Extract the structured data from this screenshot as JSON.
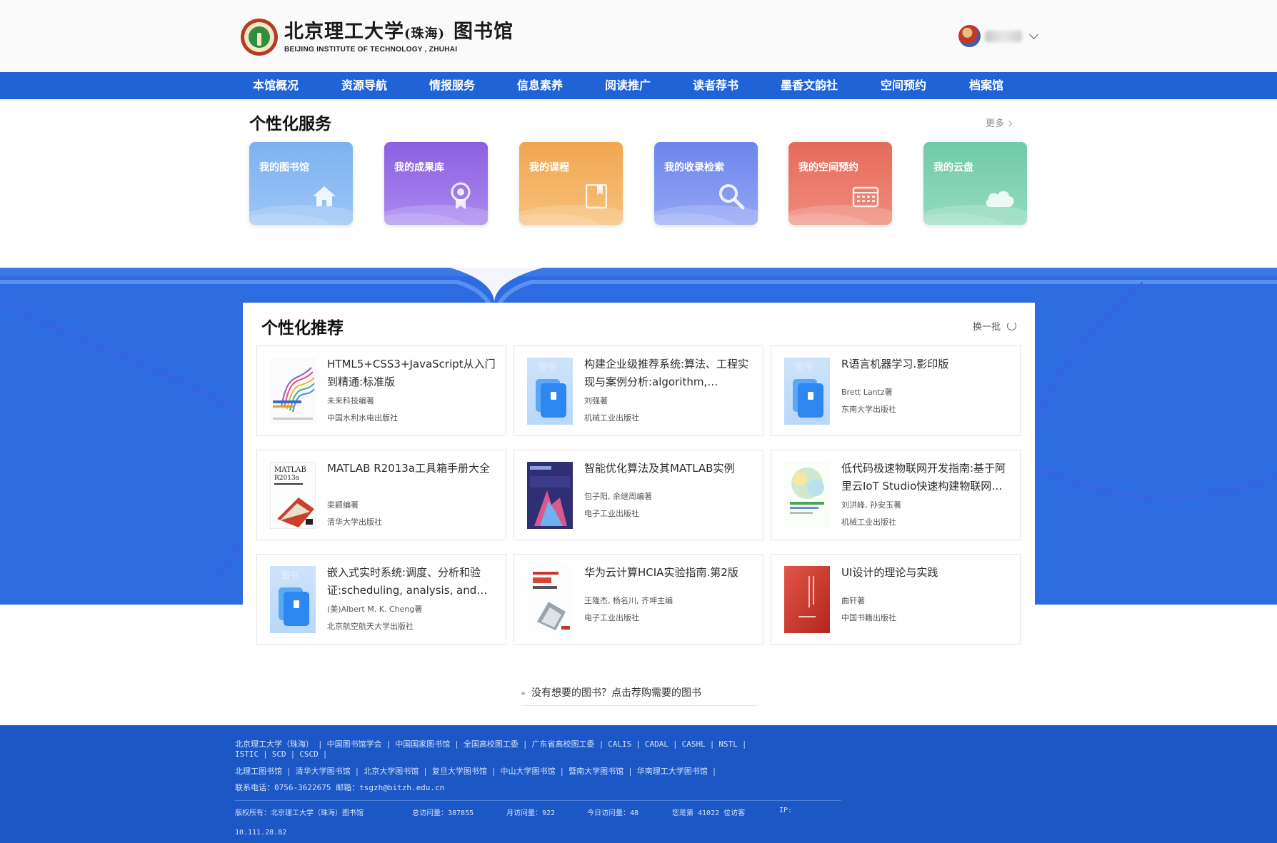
{
  "header": {
    "logo_cn": "北京理工大学",
    "logo_cn_small": "(珠海)",
    "logo_cn_lib": "图书馆",
    "logo_en": "BEIJING INSTITUTE OF TECHNOLOGY , ZHUHAI"
  },
  "nav": {
    "items": [
      "本馆概况",
      "资源导航",
      "情报服务",
      "信息素养",
      "阅读推广",
      "读者荐书",
      "墨香文韵社",
      "空间预约",
      "档案馆"
    ]
  },
  "services": {
    "title": "个性化服务",
    "more": "更多",
    "cards": [
      {
        "label": "我的图书馆",
        "icon": "house-icon",
        "color_top": "#7db1ef",
        "color_bottom": "#9cc6f5"
      },
      {
        "label": "我的成果库",
        "icon": "award-icon",
        "color_top": "#8c5fe0",
        "color_bottom": "#a98af0"
      },
      {
        "label": "我的课程",
        "icon": "book-icon",
        "color_top": "#f1a651",
        "color_bottom": "#f7c07a"
      },
      {
        "label": "我的收录检索",
        "icon": "search-icon",
        "color_top": "#6d85ec",
        "color_bottom": "#93a7f5"
      },
      {
        "label": "我的空间预约",
        "icon": "calendar-icon",
        "color_top": "#e66a5b",
        "color_bottom": "#f08c7d"
      },
      {
        "label": "我的云盘",
        "icon": "cloud-icon",
        "color_top": "#6fcaa7",
        "color_bottom": "#94dbc0"
      }
    ]
  },
  "recommend": {
    "title": "个性化推荐",
    "refresh": "换一批",
    "books": [
      {
        "title": "HTML5+CSS3+JavaScript从入门到精通:标准版",
        "author": "未来科技编著",
        "publisher": "中国水利水电出版社",
        "cover": "html-cover"
      },
      {
        "title": "构建企业级推荐系统:算法、工程实现与案例分析:algorithm, engineering implementation and case study",
        "author": "刘强著",
        "publisher": "机械工业出版社",
        "cover": "placeholder"
      },
      {
        "title": "R语言机器学习.影印版",
        "author": "Brett Lantz著",
        "publisher": "东南大学出版社",
        "cover": "placeholder"
      },
      {
        "title": "MATLAB R2013a工具箱手册大全",
        "author": "栾颖编著",
        "publisher": "清华大学出版社",
        "cover": "matlab-cover"
      },
      {
        "title": "智能优化算法及其MATLAB实例",
        "author": "包子阳, 余继周编著",
        "publisher": "电子工业出版社",
        "cover": "algo-cover"
      },
      {
        "title": "低代码极速物联网开发指南:基于阿里云IoT Studio快速构建物联网应用",
        "author": "刘洪峰, 孙安玉著",
        "publisher": "机械工业出版社",
        "cover": "iot-cover"
      },
      {
        "title": "嵌入式实时系统:调度、分析和验证:scheduling, analysis, and verification",
        "author": "(美)Albert M. K. Cheng著",
        "publisher": "北京航空航天大学出版社",
        "cover": "placeholder"
      },
      {
        "title": "华为云计算HCIA实验指南.第2版",
        "author": "王隆杰, 杨名川, 齐坤主编",
        "publisher": "电子工业出版社",
        "cover": "huawei-cover"
      },
      {
        "title": "UI设计的理论与实践",
        "author": "曲轩著",
        "publisher": "中国书籍出版社",
        "cover": "ui-cover"
      }
    ],
    "placeholder_text": "图书",
    "suggest": "没有想要的图书？点击荐购需要的图书"
  },
  "footer": {
    "links_row1": [
      "北京理工大学（珠海）",
      "中国图书馆学会",
      "中国国家图书馆",
      "全国高校图工委",
      "广东省高校图工委",
      "CALIS",
      "CADAL",
      "CASHL",
      "NSTL"
    ],
    "links_row2": [
      "ISTIC",
      "SCD",
      "CSCD"
    ],
    "links_row3": [
      "北理工图书馆",
      "清华大学图书馆",
      "北京大学图书馆",
      "复旦大学图书馆",
      "中山大学图书馆",
      "暨南大学图书馆",
      "华南理工大学图书馆"
    ],
    "contact": "联系电话：0756-3622675   邮箱：tsgzh@bitzh.edu.cn",
    "copyright": "版权所有：北京理工大学（珠海）图书馆",
    "total_visits": "总访问量：387855",
    "month_visits": "月访问量：922",
    "today_visits": "今日访问量：48",
    "visitor_no": "您是第 41022 位访客",
    "ip_label": "IP:",
    "ip": "10.111.28.82"
  }
}
